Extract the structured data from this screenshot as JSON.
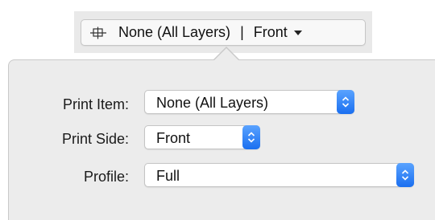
{
  "toolbar": {
    "item_label": "None (All Layers)",
    "separator": "|",
    "side_label": "Front"
  },
  "form": {
    "print_item": {
      "label": "Print Item:",
      "value": "None (All Layers)"
    },
    "print_side": {
      "label": "Print Side:",
      "value": "Front"
    },
    "profile": {
      "label": "Profile:",
      "value": "Full"
    }
  },
  "colors": {
    "accent": "#1a6ff0",
    "popover_bg": "#ececec"
  },
  "icons": {
    "toolbar": "print-layers-icon",
    "stepper": "up-down-chevrons-icon"
  }
}
